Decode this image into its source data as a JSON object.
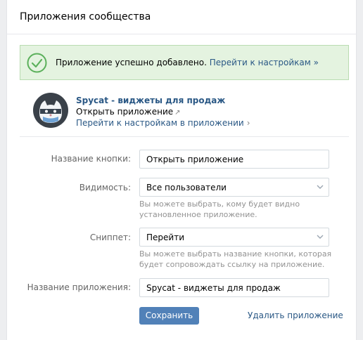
{
  "header": {
    "title": "Приложения сообщества"
  },
  "alert": {
    "message": "Приложение успешно добавлено.",
    "link": "Перейти к настройкам »",
    "color": "#e4f3e0"
  },
  "app": {
    "name": "Spycat - виджеты для продаж",
    "open_label": "Открыть приложение",
    "settings_label": "Перейти к настройкам в приложении",
    "avatar_icon": "cat-avatar-icon"
  },
  "form": {
    "button_name": {
      "label": "Название кнопки:",
      "value": "Открыть приложение"
    },
    "visibility": {
      "label": "Видимость:",
      "value": "Все пользователи",
      "hint": "Вы можете выбрать, кому будет видно установленное приложение."
    },
    "snippet": {
      "label": "Сниппет:",
      "value": "Перейти",
      "hint": "Вы можете выбрать название кнопки, которая будет сопровождать ссылку на приложение."
    },
    "app_name": {
      "label": "Название приложения:",
      "value": "Spycat - виджеты для продаж"
    }
  },
  "actions": {
    "save": "Сохранить",
    "delete": "Удалить приложение",
    "accent": "#5181b8"
  }
}
